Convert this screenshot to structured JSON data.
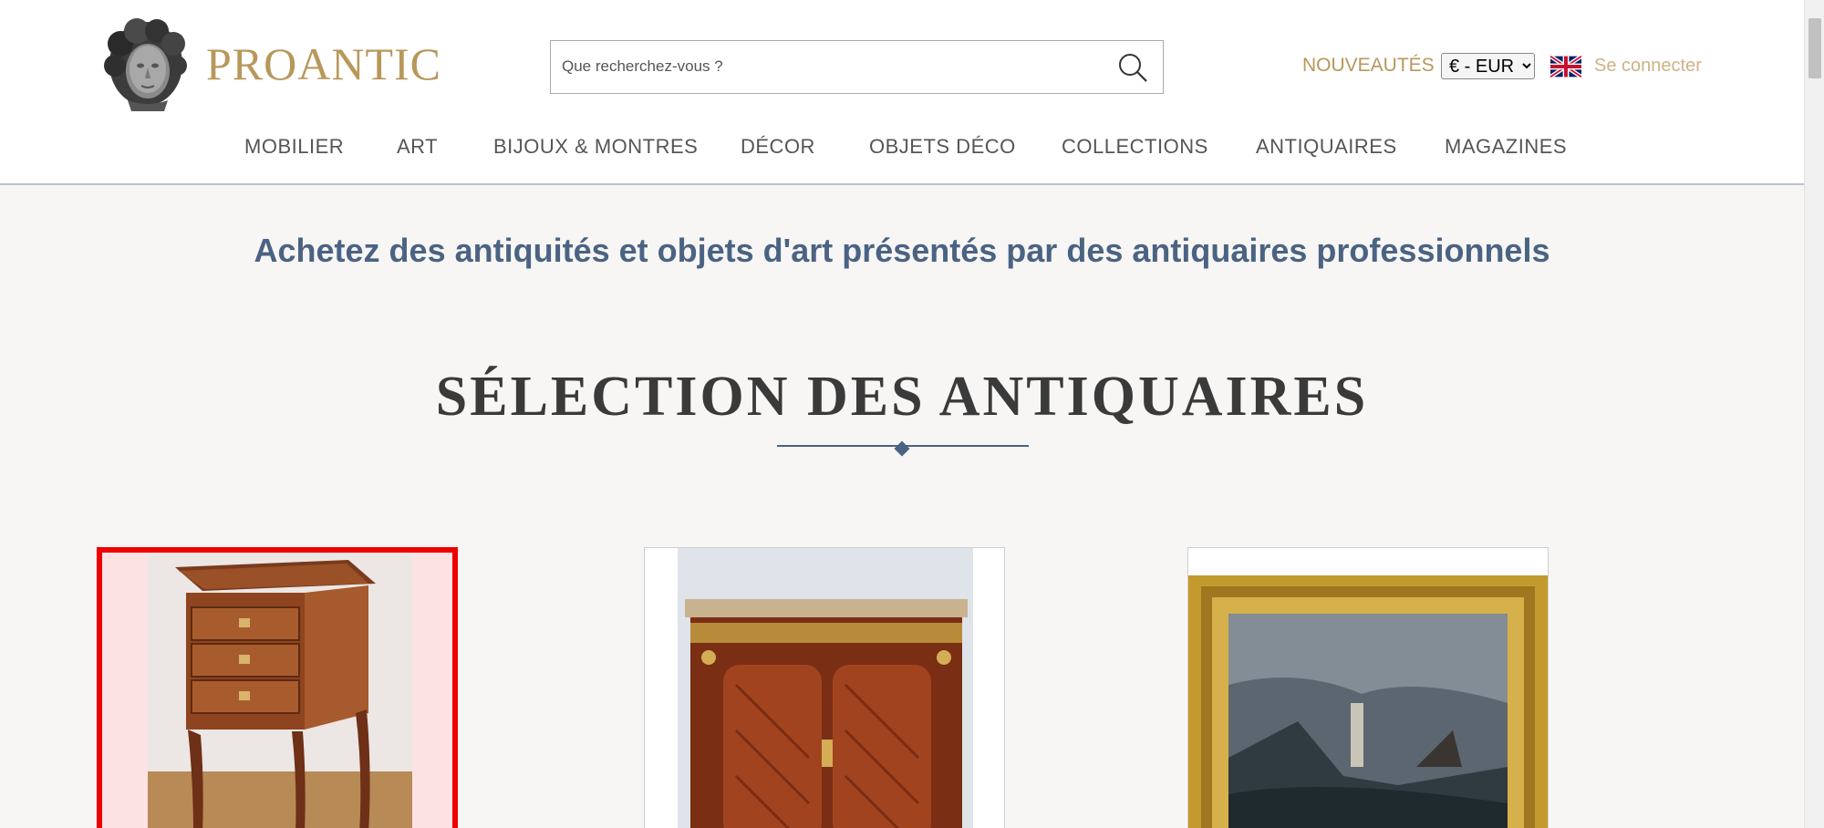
{
  "header": {
    "logo_text": "PROANTIC",
    "search_placeholder": "Que recherchez-vous ?",
    "nouveautes_label": "NOUVEAUTÉS",
    "currency_selected": "€ - EUR",
    "connect_label": "Se connecter"
  },
  "nav": {
    "items": [
      {
        "label": "MOBILIER"
      },
      {
        "label": "ART"
      },
      {
        "label": "BIJOUX & MONTRES"
      },
      {
        "label": "DÉCOR"
      },
      {
        "label": "OBJETS DÉCO"
      },
      {
        "label": "COLLECTIONS"
      },
      {
        "label": "ANTIQUAIRES"
      },
      {
        "label": "MAGAZINES"
      }
    ]
  },
  "main": {
    "tagline": "Achetez des antiquités et objets d'art présentés par des antiquaires professionnels",
    "section_title": "SÉLECTION DES ANTIQUAIRES"
  },
  "colors": {
    "brand_gold": "#b8975a",
    "text_blue": "#4b6383",
    "selection_red": "#ee0000"
  },
  "icons": [
    "logo-head-icon",
    "search-icon",
    "uk-flag-icon"
  ]
}
